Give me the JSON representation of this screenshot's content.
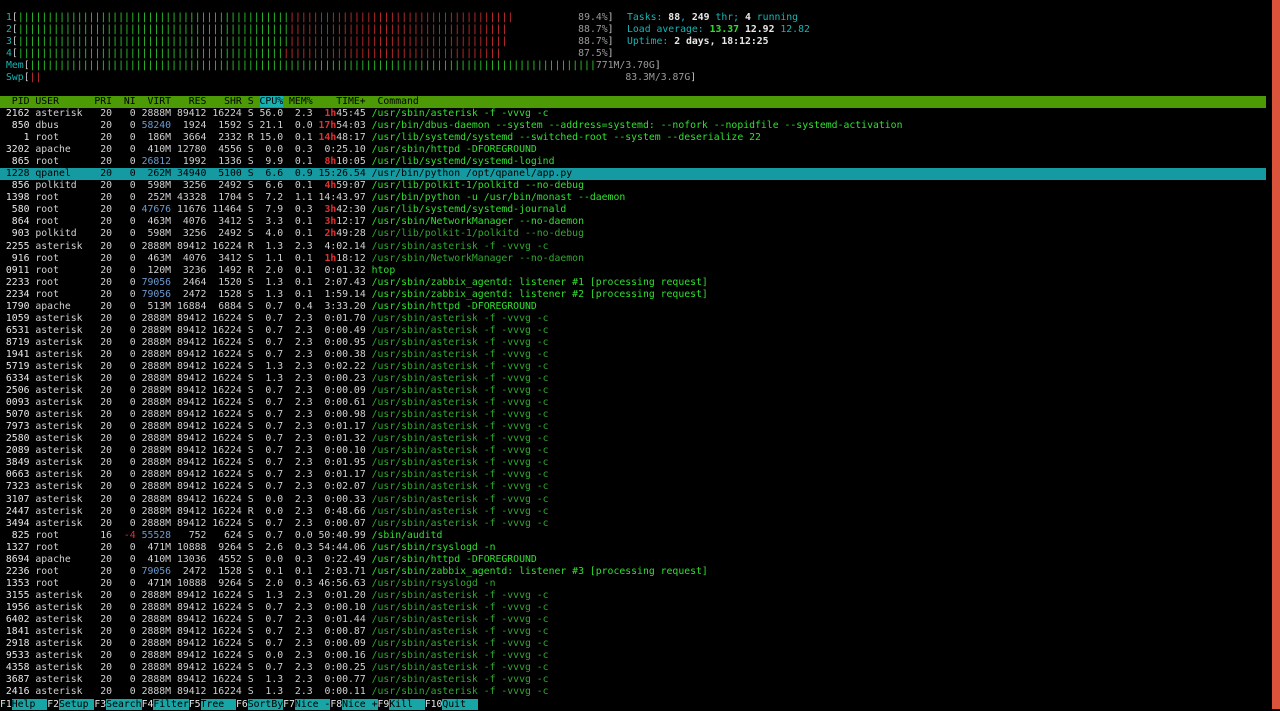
{
  "meters": {
    "cpus": [
      {
        "label": "1",
        "pct": "89.4%"
      },
      {
        "label": "2",
        "pct": "88.7%"
      },
      {
        "label": "3",
        "pct": "88.7%"
      },
      {
        "label": "4",
        "pct": "87.5%"
      }
    ],
    "mem": {
      "label": "Mem",
      "value": "771M/3.70G"
    },
    "swp": {
      "label": "Swp",
      "value": "83.3M/3.87G"
    },
    "tasks": {
      "label": "Tasks: ",
      "count": "88",
      "sep": ", ",
      "threads": "249",
      "thr_label": " thr; ",
      "running": "4",
      "running_label": " running"
    },
    "load": {
      "label": "Load average: ",
      "v1": "13.37",
      "v5": "12.92",
      "v15": "12.82"
    },
    "uptime": {
      "label": "Uptime: ",
      "value": "2 days, 18:12:25"
    }
  },
  "columns": {
    "pid": "PID",
    "user": "USER",
    "pri": "PRI",
    "ni": "NI",
    "virt": "VIRT",
    "res": "RES",
    "shr": "SHR",
    "s": "S",
    "cpu": "CPU%",
    "mem": "MEM%",
    "time": "TIME+",
    "command": "Command"
  },
  "processes": [
    {
      "pid": "2162",
      "user": "asterisk",
      "pri": "20",
      "ni": "0",
      "virt": "2888M",
      "res": "89412",
      "shr": "16224",
      "s": "S",
      "cpu": "56.0",
      "mem": "2.3",
      "time_h": "1h",
      "time": "45:45",
      "cmd": "/usr/sbin/asterisk -f -vvvg -c",
      "main": true
    },
    {
      "pid": "850",
      "user": "dbus",
      "pri": "20",
      "ni": "0",
      "virt": "58240",
      "res": "1924",
      "shr": "1592",
      "s": "S",
      "cpu": "21.1",
      "mem": "0.0",
      "time_h": "17h",
      "time": "54:03",
      "cmd": "/usr/bin/dbus-daemon --system --address=systemd: --nofork --nopidfile --systemd-activation",
      "main": true
    },
    {
      "pid": "1",
      "user": "root",
      "pri": "20",
      "ni": "0",
      "virt": "186M",
      "res": "3664",
      "shr": "2332",
      "s": "R",
      "cpu": "15.0",
      "mem": "0.1",
      "time_h": "14h",
      "time": "48:17",
      "cmd": "/usr/lib/systemd/systemd --switched-root --system --deserialize 22",
      "main": true
    },
    {
      "pid": "3202",
      "user": "apache",
      "pri": "20",
      "ni": "0",
      "virt": "410M",
      "res": "12780",
      "shr": "4556",
      "s": "S",
      "cpu": "0.0",
      "mem": "0.3",
      "time_h": "",
      "time": "0:25.10",
      "cmd": "/usr/sbin/httpd -DFOREGROUND",
      "main": true
    },
    {
      "pid": "865",
      "user": "root",
      "pri": "20",
      "ni": "0",
      "virt": "26812",
      "res": "1992",
      "shr": "1336",
      "s": "S",
      "cpu": "9.9",
      "mem": "0.1",
      "time_h": "8h",
      "time": "10:05",
      "cmd": "/usr/lib/systemd/systemd-logind",
      "main": true
    },
    {
      "pid": "1228",
      "user": "qpanel",
      "pri": "20",
      "ni": "0",
      "virt": "262M",
      "res": "34940",
      "shr": "5100",
      "s": "S",
      "cpu": "6.6",
      "mem": "0.9",
      "time_h": "",
      "time": "15:26.54",
      "cmd": "/usr/bin/python /opt/qpanel/app.py",
      "main": true,
      "selected": true
    },
    {
      "pid": "856",
      "user": "polkitd",
      "pri": "20",
      "ni": "0",
      "virt": "598M",
      "res": "3256",
      "shr": "2492",
      "s": "S",
      "cpu": "6.6",
      "mem": "0.1",
      "time_h": "4h",
      "time": "59:07",
      "cmd": "/usr/lib/polkit-1/polkitd --no-debug",
      "main": true
    },
    {
      "pid": "1398",
      "user": "root",
      "pri": "20",
      "ni": "0",
      "virt": "252M",
      "res": "43328",
      "shr": "1704",
      "s": "S",
      "cpu": "7.2",
      "mem": "1.1",
      "time_h": "",
      "time": "14:43.97",
      "cmd": "/usr/bin/python -u /usr/bin/monast --daemon",
      "main": true
    },
    {
      "pid": "580",
      "user": "root",
      "pri": "20",
      "ni": "0",
      "virt": "47676",
      "res": "11676",
      "shr": "11464",
      "s": "S",
      "cpu": "7.9",
      "mem": "0.3",
      "time_h": "3h",
      "time": "42:30",
      "cmd": "/usr/lib/systemd/systemd-journald",
      "main": true
    },
    {
      "pid": "864",
      "user": "root",
      "pri": "20",
      "ni": "0",
      "virt": "463M",
      "res": "4076",
      "shr": "3412",
      "s": "S",
      "cpu": "3.3",
      "mem": "0.1",
      "time_h": "3h",
      "time": "12:17",
      "cmd": "/usr/sbin/NetworkManager --no-daemon",
      "main": true
    },
    {
      "pid": "903",
      "user": "polkitd",
      "pri": "20",
      "ni": "0",
      "virt": "598M",
      "res": "3256",
      "shr": "2492",
      "s": "S",
      "cpu": "4.0",
      "mem": "0.1",
      "time_h": "2h",
      "time": "49:28",
      "cmd": "/usr/lib/polkit-1/polkitd --no-debug",
      "main": false
    },
    {
      "pid": "2255",
      "user": "asterisk",
      "pri": "20",
      "ni": "0",
      "virt": "2888M",
      "res": "89412",
      "shr": "16224",
      "s": "R",
      "cpu": "1.3",
      "mem": "2.3",
      "time_h": "",
      "time": "4:02.14",
      "cmd": "/usr/sbin/asterisk -f -vvvg -c",
      "main": false
    },
    {
      "pid": "916",
      "user": "root",
      "pri": "20",
      "ni": "0",
      "virt": "463M",
      "res": "4076",
      "shr": "3412",
      "s": "S",
      "cpu": "1.1",
      "mem": "0.1",
      "time_h": "1h",
      "time": "18:12",
      "cmd": "/usr/sbin/NetworkManager --no-daemon",
      "main": false
    },
    {
      "pid": "0911",
      "user": "root",
      "pri": "20",
      "ni": "0",
      "virt": "120M",
      "res": "3236",
      "shr": "1492",
      "s": "R",
      "cpu": "2.0",
      "mem": "0.1",
      "time_h": "",
      "time": "0:01.32",
      "cmd": "htop",
      "main": true
    },
    {
      "pid": "2233",
      "user": "root",
      "pri": "20",
      "ni": "0",
      "virt": "79056",
      "res": "2464",
      "shr": "1520",
      "s": "S",
      "cpu": "1.3",
      "mem": "0.1",
      "time_h": "",
      "time": "2:07.43",
      "cmd": "/usr/sbin/zabbix_agentd: listener #1 [processing request]",
      "main": true
    },
    {
      "pid": "2234",
      "user": "root",
      "pri": "20",
      "ni": "0",
      "virt": "79056",
      "res": "2472",
      "shr": "1528",
      "s": "S",
      "cpu": "1.3",
      "mem": "0.1",
      "time_h": "",
      "time": "1:59.14",
      "cmd": "/usr/sbin/zabbix_agentd: listener #2 [processing request]",
      "main": true
    },
    {
      "pid": "1790",
      "user": "apache",
      "pri": "20",
      "ni": "0",
      "virt": "513M",
      "res": "16884",
      "shr": "6884",
      "s": "S",
      "cpu": "0.7",
      "mem": "0.4",
      "time_h": "",
      "time": "3:33.20",
      "cmd": "/usr/sbin/httpd -DFOREGROUND",
      "main": true
    },
    {
      "pid": "1059",
      "user": "asterisk",
      "pri": "20",
      "ni": "0",
      "virt": "2888M",
      "res": "89412",
      "shr": "16224",
      "s": "S",
      "cpu": "0.7",
      "mem": "2.3",
      "time_h": "",
      "time": "0:01.70",
      "cmd": "/usr/sbin/asterisk -f -vvvg -c",
      "main": false
    },
    {
      "pid": "6531",
      "user": "asterisk",
      "pri": "20",
      "ni": "0",
      "virt": "2888M",
      "res": "89412",
      "shr": "16224",
      "s": "S",
      "cpu": "0.7",
      "mem": "2.3",
      "time_h": "",
      "time": "0:00.49",
      "cmd": "/usr/sbin/asterisk -f -vvvg -c",
      "main": false
    },
    {
      "pid": "8719",
      "user": "asterisk",
      "pri": "20",
      "ni": "0",
      "virt": "2888M",
      "res": "89412",
      "shr": "16224",
      "s": "S",
      "cpu": "0.7",
      "mem": "2.3",
      "time_h": "",
      "time": "0:00.95",
      "cmd": "/usr/sbin/asterisk -f -vvvg -c",
      "main": false
    },
    {
      "pid": "1941",
      "user": "asterisk",
      "pri": "20",
      "ni": "0",
      "virt": "2888M",
      "res": "89412",
      "shr": "16224",
      "s": "S",
      "cpu": "0.7",
      "mem": "2.3",
      "time_h": "",
      "time": "0:00.38",
      "cmd": "/usr/sbin/asterisk -f -vvvg -c",
      "main": false
    },
    {
      "pid": "5719",
      "user": "asterisk",
      "pri": "20",
      "ni": "0",
      "virt": "2888M",
      "res": "89412",
      "shr": "16224",
      "s": "S",
      "cpu": "1.3",
      "mem": "2.3",
      "time_h": "",
      "time": "0:02.22",
      "cmd": "/usr/sbin/asterisk -f -vvvg -c",
      "main": false
    },
    {
      "pid": "6334",
      "user": "asterisk",
      "pri": "20",
      "ni": "0",
      "virt": "2888M",
      "res": "89412",
      "shr": "16224",
      "s": "S",
      "cpu": "1.3",
      "mem": "2.3",
      "time_h": "",
      "time": "0:00.23",
      "cmd": "/usr/sbin/asterisk -f -vvvg -c",
      "main": false
    },
    {
      "pid": "2506",
      "user": "asterisk",
      "pri": "20",
      "ni": "0",
      "virt": "2888M",
      "res": "89412",
      "shr": "16224",
      "s": "S",
      "cpu": "0.7",
      "mem": "2.3",
      "time_h": "",
      "time": "0:00.09",
      "cmd": "/usr/sbin/asterisk -f -vvvg -c",
      "main": false
    },
    {
      "pid": "0093",
      "user": "asterisk",
      "pri": "20",
      "ni": "0",
      "virt": "2888M",
      "res": "89412",
      "shr": "16224",
      "s": "S",
      "cpu": "0.7",
      "mem": "2.3",
      "time_h": "",
      "time": "0:00.61",
      "cmd": "/usr/sbin/asterisk -f -vvvg -c",
      "main": false
    },
    {
      "pid": "5070",
      "user": "asterisk",
      "pri": "20",
      "ni": "0",
      "virt": "2888M",
      "res": "89412",
      "shr": "16224",
      "s": "S",
      "cpu": "0.7",
      "mem": "2.3",
      "time_h": "",
      "time": "0:00.98",
      "cmd": "/usr/sbin/asterisk -f -vvvg -c",
      "main": false
    },
    {
      "pid": "7973",
      "user": "asterisk",
      "pri": "20",
      "ni": "0",
      "virt": "2888M",
      "res": "89412",
      "shr": "16224",
      "s": "S",
      "cpu": "0.7",
      "mem": "2.3",
      "time_h": "",
      "time": "0:01.17",
      "cmd": "/usr/sbin/asterisk -f -vvvg -c",
      "main": false
    },
    {
      "pid": "2580",
      "user": "asterisk",
      "pri": "20",
      "ni": "0",
      "virt": "2888M",
      "res": "89412",
      "shr": "16224",
      "s": "S",
      "cpu": "0.7",
      "mem": "2.3",
      "time_h": "",
      "time": "0:01.32",
      "cmd": "/usr/sbin/asterisk -f -vvvg -c",
      "main": false
    },
    {
      "pid": "2089",
      "user": "asterisk",
      "pri": "20",
      "ni": "0",
      "virt": "2888M",
      "res": "89412",
      "shr": "16224",
      "s": "S",
      "cpu": "0.7",
      "mem": "2.3",
      "time_h": "",
      "time": "0:00.10",
      "cmd": "/usr/sbin/asterisk -f -vvvg -c",
      "main": false
    },
    {
      "pid": "3849",
      "user": "asterisk",
      "pri": "20",
      "ni": "0",
      "virt": "2888M",
      "res": "89412",
      "shr": "16224",
      "s": "S",
      "cpu": "0.7",
      "mem": "2.3",
      "time_h": "",
      "time": "0:01.95",
      "cmd": "/usr/sbin/asterisk -f -vvvg -c",
      "main": false
    },
    {
      "pid": "0663",
      "user": "asterisk",
      "pri": "20",
      "ni": "0",
      "virt": "2888M",
      "res": "89412",
      "shr": "16224",
      "s": "S",
      "cpu": "0.7",
      "mem": "2.3",
      "time_h": "",
      "time": "0:01.17",
      "cmd": "/usr/sbin/asterisk -f -vvvg -c",
      "main": false
    },
    {
      "pid": "7323",
      "user": "asterisk",
      "pri": "20",
      "ni": "0",
      "virt": "2888M",
      "res": "89412",
      "shr": "16224",
      "s": "S",
      "cpu": "0.7",
      "mem": "2.3",
      "time_h": "",
      "time": "0:02.07",
      "cmd": "/usr/sbin/asterisk -f -vvvg -c",
      "main": false
    },
    {
      "pid": "3107",
      "user": "asterisk",
      "pri": "20",
      "ni": "0",
      "virt": "2888M",
      "res": "89412",
      "shr": "16224",
      "s": "S",
      "cpu": "0.0",
      "mem": "2.3",
      "time_h": "",
      "time": "0:00.33",
      "cmd": "/usr/sbin/asterisk -f -vvvg -c",
      "main": false
    },
    {
      "pid": "2447",
      "user": "asterisk",
      "pri": "20",
      "ni": "0",
      "virt": "2888M",
      "res": "89412",
      "shr": "16224",
      "s": "R",
      "cpu": "0.0",
      "mem": "2.3",
      "time_h": "",
      "time": "0:48.66",
      "cmd": "/usr/sbin/asterisk -f -vvvg -c",
      "main": false
    },
    {
      "pid": "3494",
      "user": "asterisk",
      "pri": "20",
      "ni": "0",
      "virt": "2888M",
      "res": "89412",
      "shr": "16224",
      "s": "S",
      "cpu": "0.7",
      "mem": "2.3",
      "time_h": "",
      "time": "0:00.07",
      "cmd": "/usr/sbin/asterisk -f -vvvg -c",
      "main": false
    },
    {
      "pid": "825",
      "user": "root",
      "pri": "16",
      "ni": "-4",
      "virt": "55528",
      "res": "752",
      "shr": "624",
      "s": "S",
      "cpu": "0.7",
      "mem": "0.0",
      "time_h": "",
      "time": "50:40.99",
      "cmd": "/sbin/auditd",
      "main": true
    },
    {
      "pid": "1327",
      "user": "root",
      "pri": "20",
      "ni": "0",
      "virt": "471M",
      "res": "10888",
      "shr": "9264",
      "s": "S",
      "cpu": "2.6",
      "mem": "0.3",
      "time_h": "",
      "time": "54:44.06",
      "cmd": "/usr/sbin/rsyslogd -n",
      "main": true
    },
    {
      "pid": "8694",
      "user": "apache",
      "pri": "20",
      "ni": "0",
      "virt": "410M",
      "res": "13036",
      "shr": "4552",
      "s": "S",
      "cpu": "0.0",
      "mem": "0.3",
      "time_h": "",
      "time": "0:22.49",
      "cmd": "/usr/sbin/httpd -DFOREGROUND",
      "main": true
    },
    {
      "pid": "2236",
      "user": "root",
      "pri": "20",
      "ni": "0",
      "virt": "79056",
      "res": "2472",
      "shr": "1528",
      "s": "S",
      "cpu": "0.1",
      "mem": "0.1",
      "time_h": "",
      "time": "2:03.71",
      "cmd": "/usr/sbin/zabbix_agentd: listener #3 [processing request]",
      "main": true
    },
    {
      "pid": "1353",
      "user": "root",
      "pri": "20",
      "ni": "0",
      "virt": "471M",
      "res": "10888",
      "shr": "9264",
      "s": "S",
      "cpu": "2.0",
      "mem": "0.3",
      "time_h": "",
      "time": "46:56.63",
      "cmd": "/usr/sbin/rsyslogd -n",
      "main": false
    },
    {
      "pid": "3155",
      "user": "asterisk",
      "pri": "20",
      "ni": "0",
      "virt": "2888M",
      "res": "89412",
      "shr": "16224",
      "s": "S",
      "cpu": "1.3",
      "mem": "2.3",
      "time_h": "",
      "time": "0:01.20",
      "cmd": "/usr/sbin/asterisk -f -vvvg -c",
      "main": false
    },
    {
      "pid": "1956",
      "user": "asterisk",
      "pri": "20",
      "ni": "0",
      "virt": "2888M",
      "res": "89412",
      "shr": "16224",
      "s": "S",
      "cpu": "0.7",
      "mem": "2.3",
      "time_h": "",
      "time": "0:00.10",
      "cmd": "/usr/sbin/asterisk -f -vvvg -c",
      "main": false
    },
    {
      "pid": "6402",
      "user": "asterisk",
      "pri": "20",
      "ni": "0",
      "virt": "2888M",
      "res": "89412",
      "shr": "16224",
      "s": "S",
      "cpu": "0.7",
      "mem": "2.3",
      "time_h": "",
      "time": "0:01.44",
      "cmd": "/usr/sbin/asterisk -f -vvvg -c",
      "main": false
    },
    {
      "pid": "1841",
      "user": "asterisk",
      "pri": "20",
      "ni": "0",
      "virt": "2888M",
      "res": "89412",
      "shr": "16224",
      "s": "S",
      "cpu": "0.7",
      "mem": "2.3",
      "time_h": "",
      "time": "0:00.87",
      "cmd": "/usr/sbin/asterisk -f -vvvg -c",
      "main": false
    },
    {
      "pid": "2918",
      "user": "asterisk",
      "pri": "20",
      "ni": "0",
      "virt": "2888M",
      "res": "89412",
      "shr": "16224",
      "s": "S",
      "cpu": "0.7",
      "mem": "2.3",
      "time_h": "",
      "time": "0:00.09",
      "cmd": "/usr/sbin/asterisk -f -vvvg -c",
      "main": false
    },
    {
      "pid": "9533",
      "user": "asterisk",
      "pri": "20",
      "ni": "0",
      "virt": "2888M",
      "res": "89412",
      "shr": "16224",
      "s": "S",
      "cpu": "0.0",
      "mem": "2.3",
      "time_h": "",
      "time": "0:00.16",
      "cmd": "/usr/sbin/asterisk -f -vvvg -c",
      "main": false
    },
    {
      "pid": "4358",
      "user": "asterisk",
      "pri": "20",
      "ni": "0",
      "virt": "2888M",
      "res": "89412",
      "shr": "16224",
      "s": "S",
      "cpu": "0.7",
      "mem": "2.3",
      "time_h": "",
      "time": "0:00.25",
      "cmd": "/usr/sbin/asterisk -f -vvvg -c",
      "main": false
    },
    {
      "pid": "3687",
      "user": "asterisk",
      "pri": "20",
      "ni": "0",
      "virt": "2888M",
      "res": "89412",
      "shr": "16224",
      "s": "S",
      "cpu": "1.3",
      "mem": "2.3",
      "time_h": "",
      "time": "0:00.77",
      "cmd": "/usr/sbin/asterisk -f -vvvg -c",
      "main": false
    },
    {
      "pid": "2416",
      "user": "asterisk",
      "pri": "20",
      "ni": "0",
      "virt": "2888M",
      "res": "89412",
      "shr": "16224",
      "s": "S",
      "cpu": "1.3",
      "mem": "2.3",
      "time_h": "",
      "time": "0:00.11",
      "cmd": "/usr/sbin/asterisk -f -vvvg -c",
      "main": false
    }
  ],
  "footer": [
    {
      "key": "F1",
      "label": "Help"
    },
    {
      "key": "F2",
      "label": "Setup"
    },
    {
      "key": "F3",
      "label": "Search"
    },
    {
      "key": "F4",
      "label": "Filter"
    },
    {
      "key": "F5",
      "label": "Tree"
    },
    {
      "key": "F6",
      "label": "SortBy"
    },
    {
      "key": "F7",
      "label": "Nice -"
    },
    {
      "key": "F8",
      "label": "Nice +"
    },
    {
      "key": "F9",
      "label": "Kill"
    },
    {
      "key": "F10",
      "label": "Quit"
    }
  ],
  "colors": {
    "header_bg": "#4c9a06",
    "selected_bg": "#159aa1",
    "sort_col_bg": "#18b0b0",
    "footer_label_bg": "#17a5a5"
  }
}
